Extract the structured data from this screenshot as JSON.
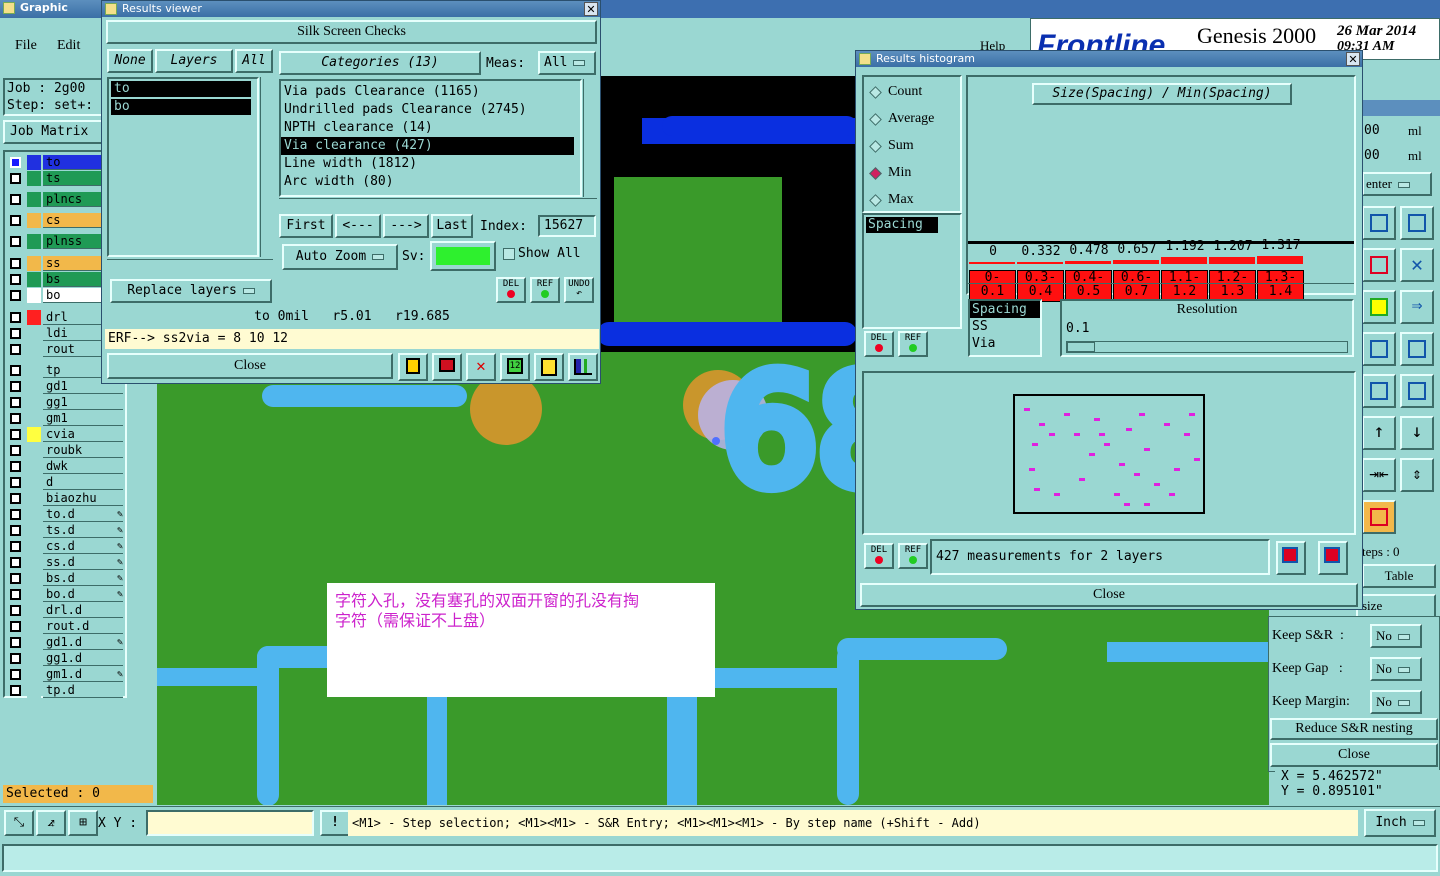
{
  "main_window": {
    "title": "Graphic Editor",
    "menu": [
      "File",
      "Edit"
    ],
    "help": "Help"
  },
  "job": {
    "job_label": "Job : 2g00",
    "step_label": "Step: set+:",
    "job_matrix": "Job Matrix"
  },
  "layers": [
    {
      "name": "to",
      "color": "#2030e0",
      "flag": false,
      "selected": true
    },
    {
      "name": "ts",
      "color": "#1f9a55",
      "flag": false
    },
    {
      "name": "plncs",
      "color": "#1f9a55",
      "flag": false
    },
    {
      "name": "cs",
      "color": "#f2b84a",
      "flag": false
    },
    {
      "name": "plnss",
      "color": "#1f9a55",
      "flag": false
    },
    {
      "name": "ss",
      "color": "#f2b84a",
      "flag": false
    },
    {
      "name": "bs",
      "color": "#1f9a55",
      "flag": false
    },
    {
      "name": "bo",
      "color": "#ffffff",
      "flag": false
    },
    {
      "name": "drl",
      "color": "#ff2020",
      "flag": false
    },
    {
      "name": "ldi",
      "color": "#9ad7d2",
      "flag": false
    },
    {
      "name": "rout",
      "color": "#9ad7d2",
      "flag": false
    },
    {
      "name": "tp",
      "color": "#9ad7d2",
      "flag": false
    },
    {
      "name": "gd1",
      "color": "#9ad7d2",
      "flag": false
    },
    {
      "name": "gg1",
      "color": "#9ad7d2",
      "flag": false
    },
    {
      "name": "gm1",
      "color": "#9ad7d2",
      "flag": false
    },
    {
      "name": "cvia",
      "color": "#ffff40",
      "flag": false
    },
    {
      "name": "roubk",
      "color": "#9ad7d2",
      "flag": false
    },
    {
      "name": "dwk",
      "color": "#9ad7d2",
      "flag": false
    },
    {
      "name": "d",
      "color": "#9ad7d2",
      "flag": false
    },
    {
      "name": "biaozhu",
      "color": "#9ad7d2",
      "flag": false
    },
    {
      "name": "to.d",
      "color": "#9ad7d2",
      "flag": true
    },
    {
      "name": "ts.d",
      "color": "#9ad7d2",
      "flag": true
    },
    {
      "name": "cs.d",
      "color": "#9ad7d2",
      "flag": true
    },
    {
      "name": "ss.d",
      "color": "#9ad7d2",
      "flag": true
    },
    {
      "name": "bs.d",
      "color": "#9ad7d2",
      "flag": true
    },
    {
      "name": "bo.d",
      "color": "#9ad7d2",
      "flag": true
    },
    {
      "name": "drl.d",
      "color": "#9ad7d2",
      "flag": false
    },
    {
      "name": "rout.d",
      "color": "#9ad7d2",
      "flag": false
    },
    {
      "name": "gd1.d",
      "color": "#9ad7d2",
      "flag": true
    },
    {
      "name": "gg1.d",
      "color": "#9ad7d2",
      "flag": false
    },
    {
      "name": "gm1.d",
      "color": "#9ad7d2",
      "flag": true
    },
    {
      "name": "tp.d",
      "color": "#9ad7d2",
      "flag": false
    }
  ],
  "selected_count": "Selected : 0",
  "canvas": {
    "label_68": "68",
    "note_line1": "字符入孔，没有塞孔的双面开窗的孔没有掏",
    "note_line2": "字符（需保证不上盘）"
  },
  "results_viewer": {
    "title": "Results viewer",
    "header": "Silk Screen Checks",
    "btn_none": "None",
    "btn_layers": "Layers",
    "btn_all": "All",
    "layers": [
      "to",
      "bo"
    ],
    "categories_label": "Categories (13)",
    "meas_label": "Meas:",
    "meas_value": "All",
    "categories": [
      "Via pads Clearance (1165)",
      "Undrilled pads Clearance (2745)",
      "NPTH clearance (14)",
      "Via clearance (427)",
      "Line width (1812)",
      "Arc width (80)"
    ],
    "selected_category": "Via clearance (427)",
    "btn_first": "First",
    "btn_prev": "<---",
    "btn_next": "--->",
    "btn_last": "Last",
    "index_label": "Index:",
    "index_value": "15627",
    "auto_zoom": "Auto Zoom",
    "sv_label": "Sv:",
    "show_all": "Show All",
    "replace_layers": "Replace layers",
    "icon_del": "DEL",
    "icon_ref": "REF",
    "icon_undo": "UNDO",
    "info_line": "to 0mil   r5.01   r19.685",
    "erf_line": "ERF--> ss2via = 8 10 12",
    "close": "Close"
  },
  "frontline": {
    "logo": "Frontline",
    "product": "Genesis 2000",
    "date": "26 Mar 2014",
    "time": "09:31 AM"
  },
  "histogram": {
    "title": "Results histogram",
    "modes": [
      "Count",
      "Average",
      "Sum",
      "Min",
      "Max"
    ],
    "selected_mode": "Min",
    "chart_title": "Size(Spacing) / Min(Spacing)",
    "list1": [
      "Spacing"
    ],
    "list2": [
      "Spacing",
      "SS",
      "Via"
    ],
    "resolution_label": "Resolution",
    "resolution_value": "0.1",
    "icon_del": "DEL",
    "icon_ref": "REF",
    "status": "427 measurements for 2 layers",
    "close": "Close"
  },
  "chart_data": {
    "type": "bar",
    "title": "Size(Spacing) / Min(Spacing)",
    "categories": [
      "0-0.1",
      "0.3-0.4",
      "0.4-0.5",
      "0.6-0.7",
      "1.1-1.2",
      "1.2-1.3",
      "1.3-1.4"
    ],
    "category_labels": [
      [
        "0-",
        "0.1"
      ],
      [
        "0.3-",
        "0.4"
      ],
      [
        "0.4-",
        "0.5"
      ],
      [
        "0.6-",
        "0.7"
      ],
      [
        "1.1-",
        "1.2"
      ],
      [
        "1.2-",
        "1.3"
      ],
      [
        "1.3-",
        "1.4"
      ]
    ],
    "values": [
      0,
      0.332,
      0.478,
      0.657,
      1.192,
      1.207,
      1.317
    ],
    "value_labels": [
      "0",
      "0.332",
      "0.478",
      "0.657",
      "1.192",
      "1.207",
      "1.317"
    ],
    "bar_color": "#ff1010"
  },
  "right_panel": {
    "field1_value": "00",
    "field1_unit": "ml",
    "field2_value": "00",
    "field2_unit": "ml",
    "center": "enter",
    "steps": "teps : 0",
    "table": "Table",
    "size": "size",
    "keep_sr_label": "Keep S&R  :",
    "keep_sr_value": "No",
    "keep_gap_label": "Keep Gap   :",
    "keep_gap_value": "No",
    "keep_margin_label": "Keep Margin:",
    "keep_margin_value": "No",
    "reduce": "Reduce S&R nesting",
    "close": "Close",
    "x_coord": "X = 5.462572\"",
    "y_coord": "Y = 0.895101\""
  },
  "bottom": {
    "xy_label": "X Y :",
    "xy_value": "",
    "hint": "<M1> - Step selection; <M1><M1> - S&R Entry; <M1><M1><M1> - By step name (+Shift - Add)",
    "units": "Inch"
  }
}
